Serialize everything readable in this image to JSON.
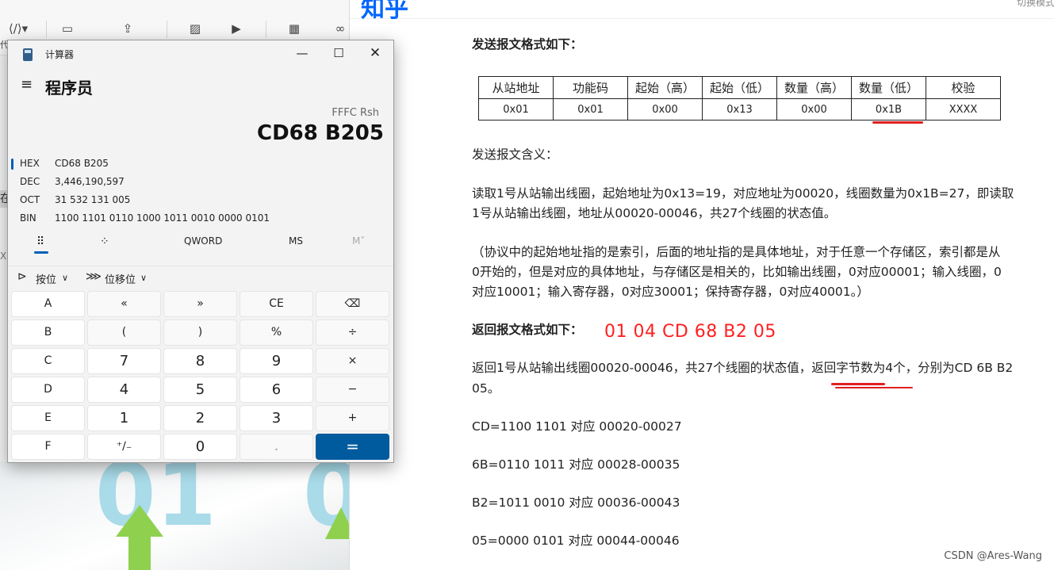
{
  "editor": {
    "toolbar_icons": [
      "code-icon",
      "html-block-icon",
      "upload-icon",
      "image-icon",
      "video-icon",
      "table-icon",
      "link-icon"
    ],
    "side_fragment_1": "代",
    "side_fragment_2": "在",
    "side_fragment_3": "X",
    "art_digit_left": "01",
    "art_digit_right": "0"
  },
  "article": {
    "logo": "知乎",
    "switch_mode": "切换模式",
    "send_format_heading": "发送报文格式如下：",
    "table_headers": [
      "从站地址",
      "功能码",
      "起始（高）",
      "起始（低）",
      "数量（高）",
      "数量（低）",
      "校验"
    ],
    "table_values": [
      "0x01",
      "0x01",
      "0x00",
      "0x13",
      "0x00",
      "0x1B",
      "XXXX"
    ],
    "send_meaning_heading": "发送报文含义：",
    "send_meaning_line1": "读取1号从站输出线圈，起始地址为0x13=19，对应地址为00020，线圈数量为0x1B=27，即读取",
    "send_meaning_line2": "1号从站输出线圈，地址从00020-00046，共27个线圈的状态值。",
    "note_line1": "（协议中的起始地址指的是索引，后面的地址指的是具体地址，对于任意一个存储区，索引都是从",
    "note_line2": "0开始的，但是对应的具体地址，与存储区是相关的，比如输出线圈，0对应00001；输入线圈，0",
    "note_line3": "对应10001；输入寄存器，0对应30001；保持寄存器，0对应40001。）",
    "reply_format_heading": "返回报文格式如下：",
    "reply_hex": "01 04 CD 68 B2 05",
    "reply_line1": "返回1号从站输出线圈00020-00046，共27个线圈的状态值，返回字节数为4个，分别为CD 6B B2",
    "reply_line2": "05。",
    "byte_lines": [
      "CD=1100 1101 对应 00020-00027",
      "6B=0110 1011 对应 00028-00035",
      "B2=1011 0010 对应 00036-00043",
      "05=0000 0101 对应 00044-00046"
    ],
    "watermark": "CSDN @Ares-Wang",
    "underline_color": "#e02020"
  },
  "calculator": {
    "title": "计算器",
    "mode": "程序员",
    "expression": "FFFC Rsh",
    "display": "CD68 B205",
    "radix": [
      {
        "name": "HEX",
        "value": "CD68 B205"
      },
      {
        "name": "DEC",
        "value": "3,446,190,597"
      },
      {
        "name": "OCT",
        "value": "31 532 131 005"
      },
      {
        "name": "BIN",
        "value": "1100 1101 0110 1000 1011 0010 0000 0101"
      }
    ],
    "word_size": "QWORD",
    "memory_store": "MS",
    "memory_recall": "M˅",
    "bitwise": "按位",
    "bitshift": "位移位",
    "accent": "#005fb8",
    "equals_color": "#005a9e",
    "keys": [
      [
        "A",
        "«",
        "»",
        "CE",
        "⌫"
      ],
      [
        "B",
        "(",
        ")",
        "%",
        "÷"
      ],
      [
        "C",
        "7",
        "8",
        "9",
        "×"
      ],
      [
        "D",
        "4",
        "5",
        "6",
        "−"
      ],
      [
        "E",
        "1",
        "2",
        "3",
        "+"
      ],
      [
        "F",
        "⁺∕₋",
        "0",
        ".",
        "="
      ]
    ]
  }
}
